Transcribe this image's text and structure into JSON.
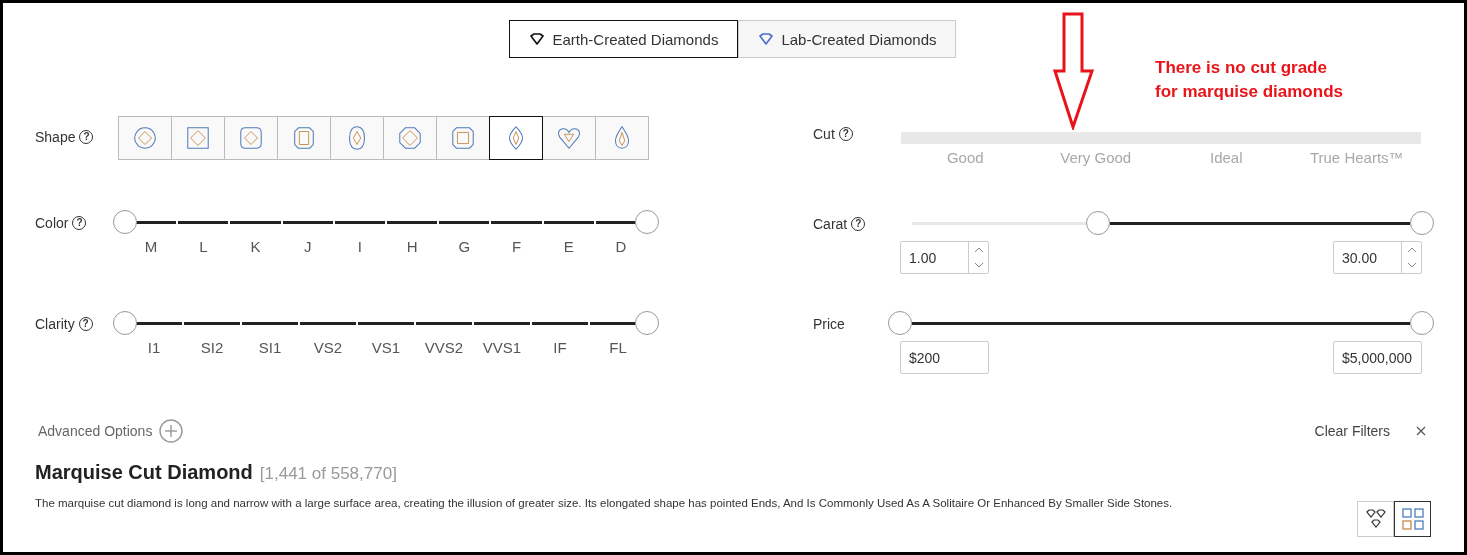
{
  "source_tabs": [
    {
      "kind": "earth",
      "label": "Earth-Created Diamonds",
      "selected": true
    },
    {
      "kind": "lab",
      "label": "Lab-Created Diamonds",
      "selected": false
    }
  ],
  "shape": {
    "label": "Shape",
    "help": "?",
    "options": [
      {
        "kind": "round",
        "selected": false
      },
      {
        "kind": "princess",
        "selected": false
      },
      {
        "kind": "cushion",
        "selected": false
      },
      {
        "kind": "emerald",
        "selected": false
      },
      {
        "kind": "oval",
        "selected": false
      },
      {
        "kind": "asscher",
        "selected": false
      },
      {
        "kind": "radiant",
        "selected": false
      },
      {
        "kind": "marquise",
        "selected": true
      },
      {
        "kind": "heart",
        "selected": false
      },
      {
        "kind": "pear",
        "selected": false
      }
    ]
  },
  "color": {
    "label": "Color",
    "help": "?",
    "grades": [
      "M",
      "L",
      "K",
      "J",
      "I",
      "H",
      "G",
      "F",
      "E",
      "D"
    ],
    "thumbs": [
      {
        "level": 0
      },
      {
        "level": 1
      }
    ]
  },
  "clarity": {
    "label": "Clarity",
    "help": "?",
    "grades": [
      "I1",
      "SI2",
      "SI1",
      "VS2",
      "VS1",
      "VVS2",
      "VVS1",
      "IF",
      "FL"
    ],
    "thumbs": [
      {
        "level": 0
      },
      {
        "level": 1
      }
    ]
  },
  "cut": {
    "label": "Cut",
    "help": "?",
    "disabled": true,
    "grades": [
      "Good",
      "Very Good",
      "Ideal",
      "True Hearts™"
    ]
  },
  "carat": {
    "label": "Carat",
    "help": "?",
    "thumbs": [
      {
        "level": 0.38
      },
      {
        "level": 1
      }
    ],
    "min": "1.00",
    "max": "30.00"
  },
  "price": {
    "label": "Price",
    "thumbs": [
      {
        "level": 0
      },
      {
        "level": 1
      }
    ],
    "min": "$200",
    "max": "$5,000,000"
  },
  "advanced_options": {
    "label": "Advanced Options",
    "expanded": false
  },
  "clear_filters": {
    "label": "Clear Filters"
  },
  "results": {
    "title": "Marquise Cut Diamond",
    "count": "[1,441 of 558,770]",
    "description": "The marquise cut diamond is long and narrow with a large surface area, creating the illusion of greater size. Its elongated shape has pointed Ends, And Is Commonly Used As A Solitaire Or Enhanced By Smaller Side Stones."
  },
  "view_modes": [
    {
      "kind": "shapes",
      "selected": false
    },
    {
      "kind": "grid",
      "selected": true
    }
  ],
  "annotation": {
    "lines": [
      "There is no cut grade",
      "for marquise diamonds"
    ]
  }
}
